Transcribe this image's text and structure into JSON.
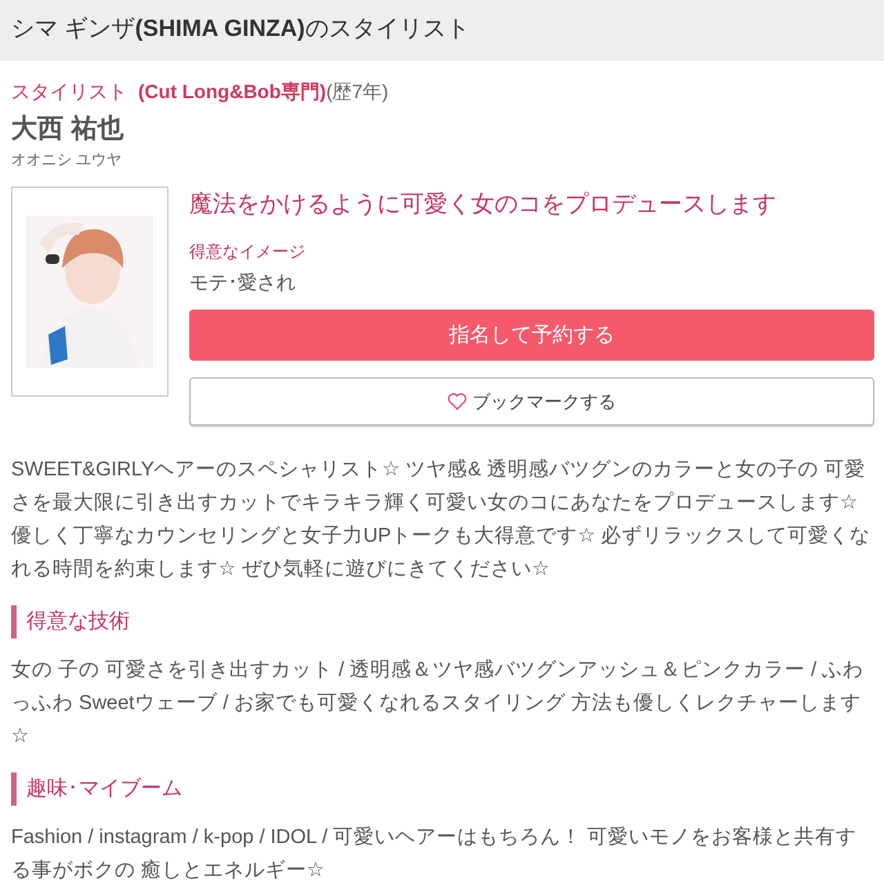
{
  "header": {
    "title": "シマ ギンザ**(SHIMA GINZA)**のスタイリスト"
  },
  "stylist": {
    "role": "スタイリスト",
    "specialty": "(Cut Long&Bob専門)",
    "years": "(歴7年)",
    "name": "大西 祐也",
    "kana": "オオニシ ユウヤ"
  },
  "profile": {
    "catchphrase": "魔法をかけるように可愛く女のコをプロデュースします",
    "image_label": "得意なイメージ",
    "image_value": "モテ･愛され",
    "reserve_button": "指名して予約する",
    "bookmark_button": "ブックマークする"
  },
  "description": "SWEET&GIRLYヘアーのスペシャリスト☆ ツヤ感& 透明感バツグンのカラーと女の子の 可愛さを最大限に引き出すカットでキラキラ輝く可愛い女のコにあなたをプロデュースします☆ 優しく丁寧なカウンセリングと女子力UPトークも大得意です☆ 必ずリラックスして可愛くなれる時間を約束します☆ ぜひ気軽に遊びにきてください☆",
  "sections": [
    {
      "heading": "得意な技術",
      "body": "女の 子の 可愛さを引き出すカット / 透明感＆ツヤ感バツグンアッシュ＆ピンクカラー / ふわっふわ Sweetウェーブ / お家でも可愛くなれるスタイリング 方法も優しくレクチャーします☆"
    },
    {
      "heading": "趣味･マイブーム",
      "body": "Fashion / instagram / k-pop / IDOL / 可愛いヘアーはもちろん！ 可愛いモノをお客様と共有する事がボクの 癒しとエネルギー☆"
    }
  ]
}
